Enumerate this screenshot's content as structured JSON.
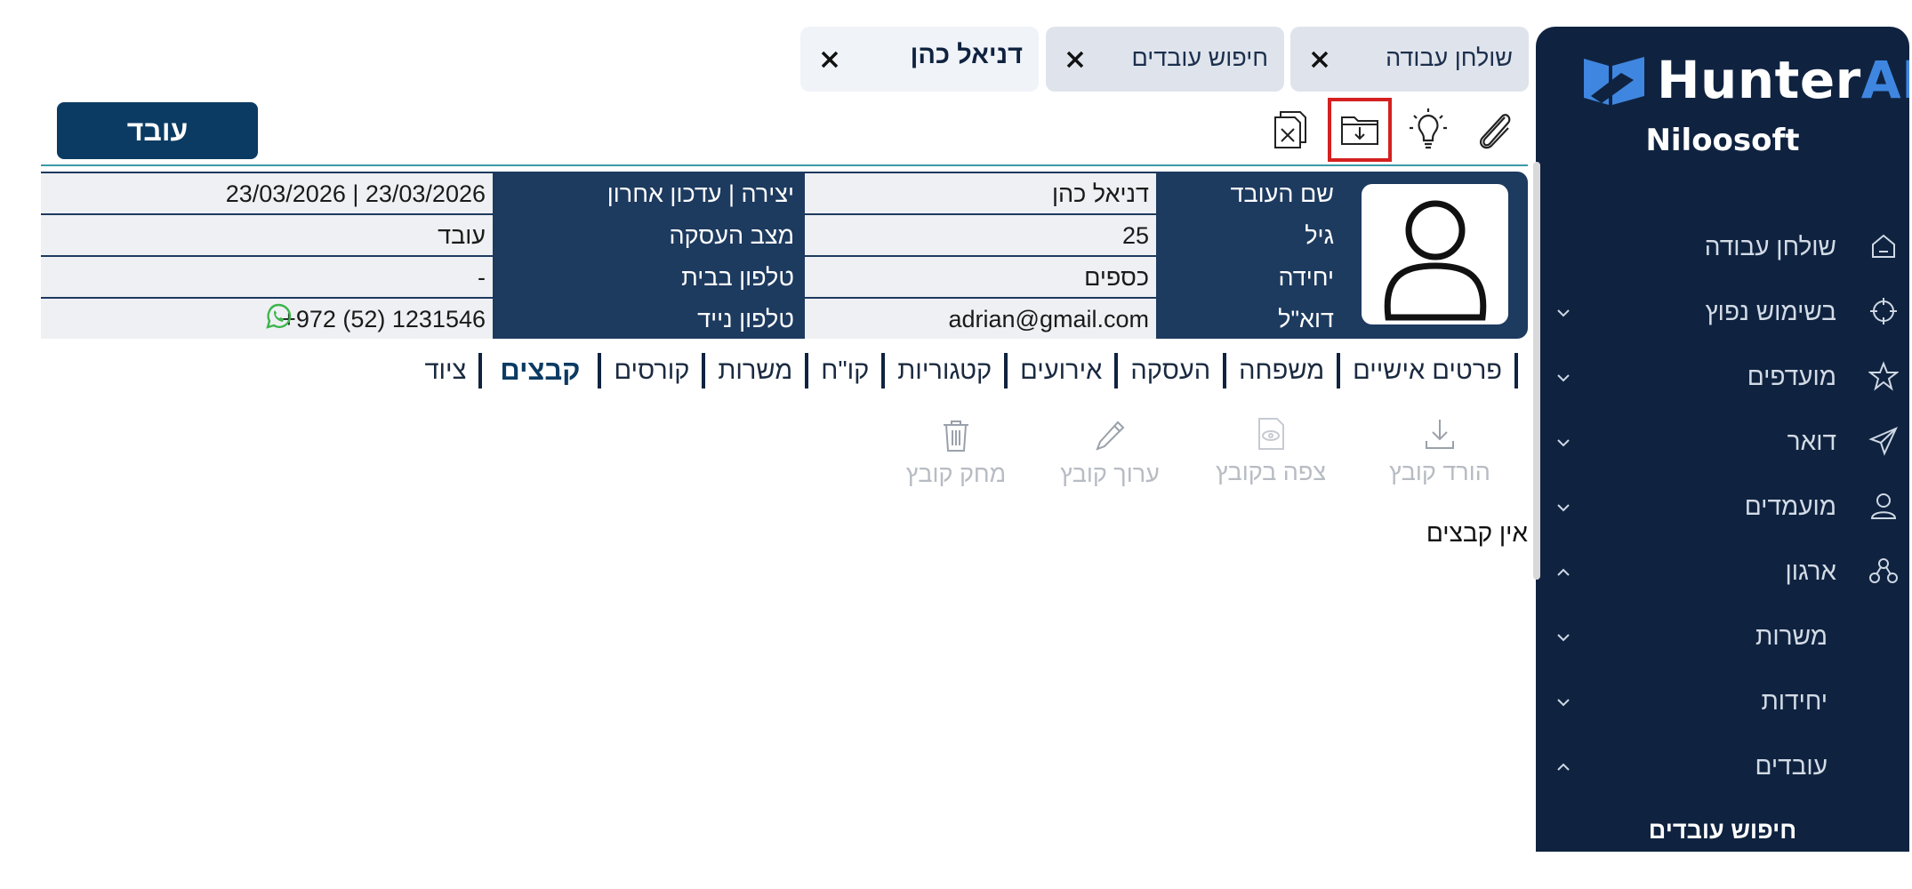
{
  "brand": {
    "logo_text_main": "Hunter",
    "logo_text_accent": "AI",
    "accent_color": "#3f86e0",
    "sidebar_color": "#0f2340",
    "company": "Niloosoft"
  },
  "sidebar": {
    "items": [
      {
        "label": "שולחן עבודה",
        "icon": "home-icon"
      },
      {
        "label": "בשימוש נפוץ",
        "icon": "crosshair-icon"
      },
      {
        "label": "מועדפים",
        "icon": "star-icon"
      },
      {
        "label": "דואר",
        "icon": "send-icon"
      },
      {
        "label": "מועמדים",
        "icon": "person-icon"
      },
      {
        "label": "ארגון",
        "icon": "org-icon"
      },
      {
        "label": "משרות"
      },
      {
        "label": "יחידות"
      },
      {
        "label": "עובדים"
      },
      {
        "label": "חיפוש עובדים"
      }
    ]
  },
  "tabs": [
    {
      "label": "שולחן עבודה"
    },
    {
      "label": "חיפוש עובדים"
    },
    {
      "label": "דניאל כהן"
    }
  ],
  "toolbar": {
    "status_button": "עובד",
    "tools": [
      "paperclip-icon",
      "lightbulb-icon",
      "folder-download-icon",
      "excel-export-icon"
    ],
    "highlight_color": "#d42020"
  },
  "employee": {
    "labels": {
      "name": "שם העובד",
      "age": "גיל",
      "unit": "יחידה",
      "email": "דוא\"ל",
      "created": "יצירה | עדכון אחרון",
      "status": "מצב העסקה",
      "home_phone": "טלפון בבית",
      "mobile": "טלפון נייד"
    },
    "values": {
      "name": "דניאל כהן",
      "age": "25",
      "unit": "כספים",
      "email": "adrian@gmail.com",
      "created": "23/03/2026  |  23/03/2026",
      "status": "עובד",
      "home_phone": "-",
      "mobile": "+972 (52) 1231546"
    }
  },
  "subtabs": [
    "פרטים אישיים",
    "משפחה",
    "העסקה",
    "אירועים",
    "קטגוריות",
    "קו\"ח",
    "משרות",
    "קורסים",
    "קבצים",
    "ציוד"
  ],
  "active_subtab": "קבצים",
  "file_actions": {
    "download": "הורד קובץ",
    "view": "צפה בקובץ",
    "edit": "ערוך קובץ",
    "delete": "מחק קובץ"
  },
  "files_empty": "אין קבצים"
}
